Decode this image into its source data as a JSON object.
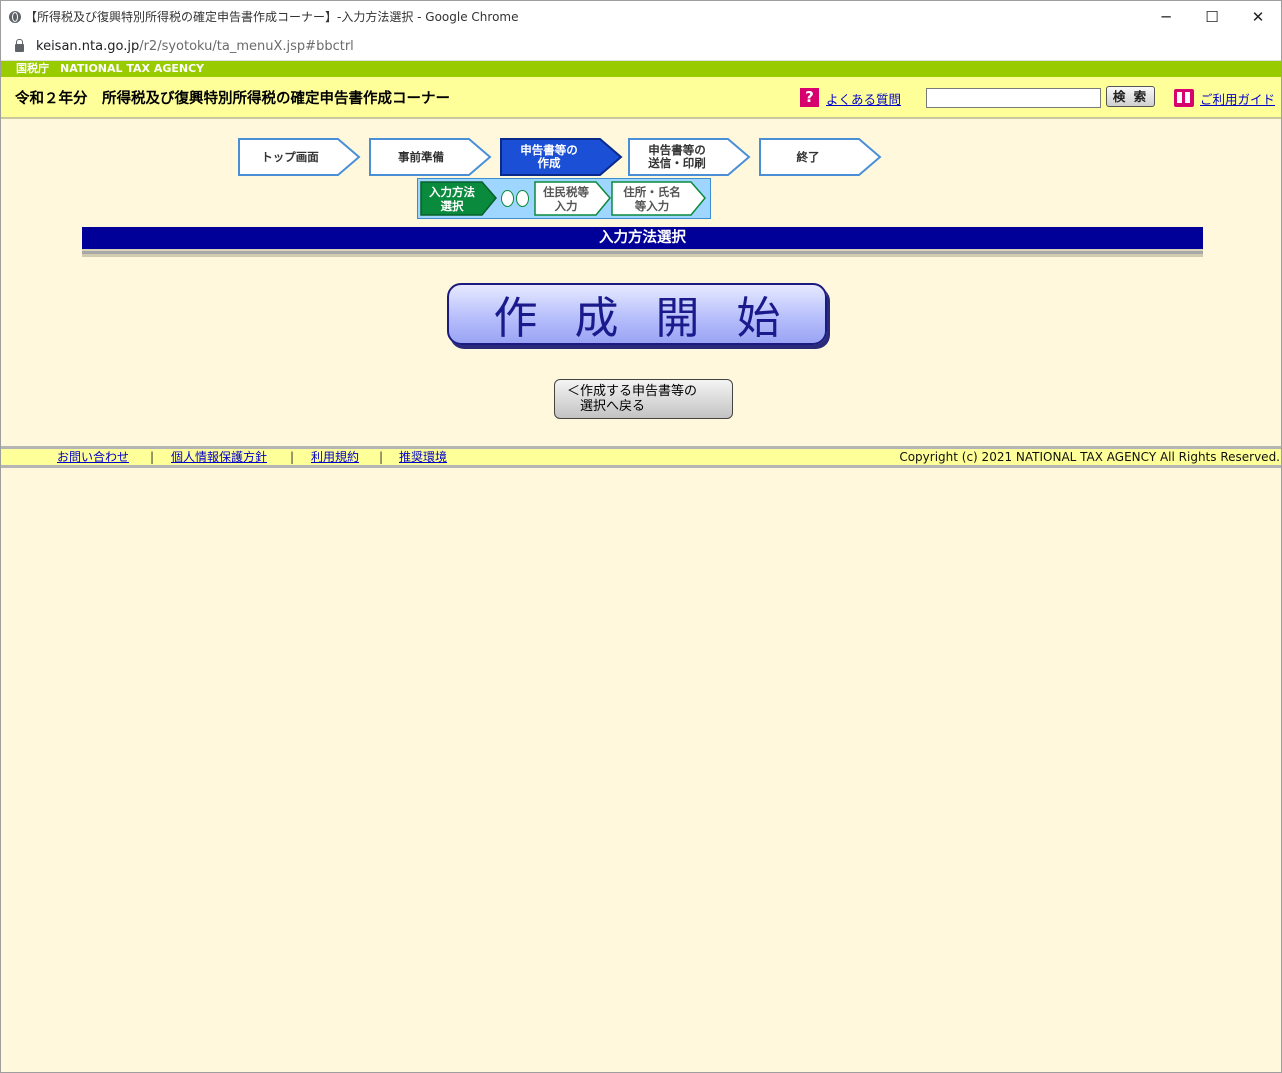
{
  "browser": {
    "window_title": "【所得税及び復興特別所得税の確定申告書作成コーナー】-入力方法選択 - Google Chrome",
    "url_host": "keisan.nta.go.jp",
    "url_path": "/r2/syotoku/ta_menuX.jsp#bbctrl",
    "minimize": "─",
    "maximize": "☐",
    "close": "✕"
  },
  "site": {
    "agency_name": "国税庁　NATIONAL TAX AGENCY",
    "header_title": "令和２年分　所得税及び復興特別所得税の確定申告書作成コーナー",
    "faq_icon": "?",
    "faq_label": "よくある質問",
    "search_value": "",
    "search_button": "検 索",
    "guide_label": "ご利用ガイド"
  },
  "steps": [
    {
      "label": "トップ画面",
      "active": false
    },
    {
      "label": "事前準備",
      "active": false
    },
    {
      "label": "申告書等の\n作成",
      "active": true
    },
    {
      "label": "申告書等の\n送信・印刷",
      "active": false
    },
    {
      "label": "終了",
      "active": false
    }
  ],
  "substeps": [
    {
      "label": "入力方法\n選択",
      "active": true
    },
    {
      "label": "住民税等\n入力",
      "active": false
    },
    {
      "label": "住所・氏名\n等入力",
      "active": false
    }
  ],
  "section_title": "入力方法選択",
  "start_button": [
    "作",
    "成",
    "開",
    "始"
  ],
  "back_button": "＜作成する申告書等の\n　選択へ戻る",
  "footer": {
    "links": [
      "お問い合わせ",
      "個人情報保護方針",
      "利用規約",
      "推奨環境"
    ],
    "separator": "|",
    "copyright": "Copyright (c) 2021 NATIONAL TAX AGENCY All Rights Reserved."
  },
  "colors": {
    "step_active": "#1a4fd6",
    "step_border": "#4a8fd6",
    "substep_active": "#0a8a3c",
    "section_bar": "#000099"
  }
}
